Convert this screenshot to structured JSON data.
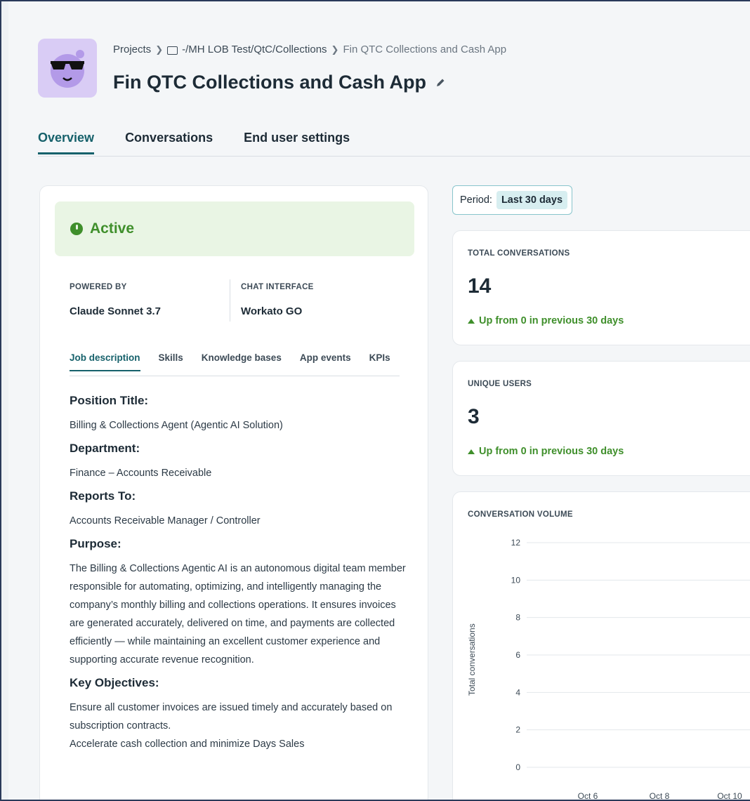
{
  "breadcrumb": {
    "root": "Projects",
    "folder": "-/MH LOB Test/QtC/Collections",
    "current": "Fin QTC Collections and Cash App"
  },
  "page_title": "Fin QTC Collections and Cash App",
  "tabs": [
    {
      "label": "Overview",
      "active": true
    },
    {
      "label": "Conversations",
      "active": false
    },
    {
      "label": "End user settings",
      "active": false
    }
  ],
  "status": {
    "label": "Active",
    "color": "#3f8f2b"
  },
  "meta": {
    "powered_by_label": "POWERED BY",
    "powered_by_value": "Claude Sonnet 3.7",
    "chat_interface_label": "CHAT INTERFACE",
    "chat_interface_value": "Workato GO"
  },
  "subtabs": [
    {
      "label": "Job description",
      "active": true
    },
    {
      "label": "Skills",
      "active": false
    },
    {
      "label": "Knowledge bases",
      "active": false
    },
    {
      "label": "App events",
      "active": false
    },
    {
      "label": "KPIs",
      "active": false
    }
  ],
  "doc": {
    "position_title_h": "Position Title:",
    "position_title": "Billing & Collections Agent (Agentic AI Solution)",
    "department_h": "Department:",
    "department": "Finance – Accounts Receivable",
    "reports_to_h": "Reports To:",
    "reports_to": "Accounts Receivable Manager / Controller",
    "purpose_h": "Purpose:",
    "purpose": "The Billing & Collections Agentic AI is an autonomous digital team member responsible for automating, optimizing, and intelligently managing the company’s monthly billing and collections operations. It ensures invoices are generated accurately, delivered on time, and payments are collected efficiently — while maintaining an excellent customer experience and supporting accurate revenue recognition.",
    "objectives_h": "Key Objectives:",
    "objective_1": "Ensure all customer invoices are issued timely and accurately based on subscription contracts.",
    "objective_2": "Accelerate cash collection and minimize Days Sales"
  },
  "period": {
    "label": "Period:",
    "value": "Last 30 days"
  },
  "total_conversations": {
    "label": "TOTAL CONVERSATIONS",
    "value": "14",
    "trend": "Up from 0 in previous 30 days"
  },
  "unique_users": {
    "label": "UNIQUE USERS",
    "value": "3",
    "trend": "Up from 0 in previous 30 days"
  },
  "chart_data": {
    "type": "bar",
    "title": "CONVERSATION VOLUME",
    "ylabel": "Total conversations",
    "xlabel": "",
    "ylim": [
      0,
      12
    ],
    "yticks": [
      0,
      2,
      4,
      6,
      8,
      10,
      12
    ],
    "categories": [
      "Oct 6",
      "Oct 8",
      "Oct 10"
    ],
    "values": [
      0,
      0,
      0
    ],
    "grid": true
  }
}
